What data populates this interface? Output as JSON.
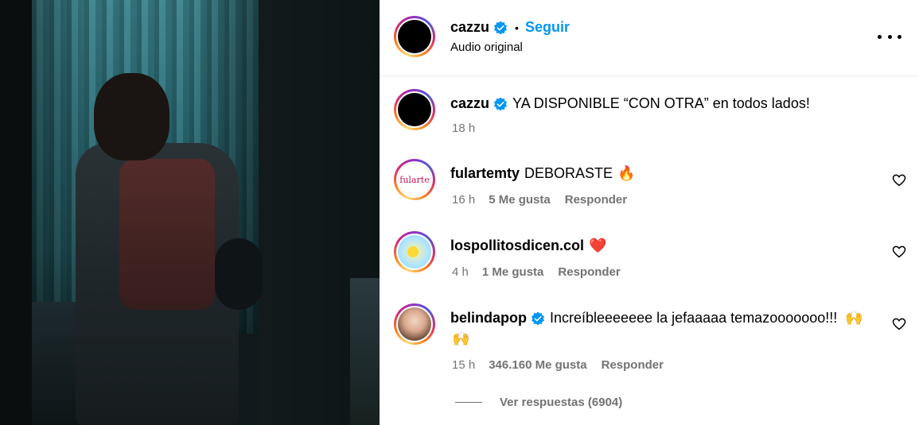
{
  "post": {
    "author": "cazzu",
    "follow_label": "Seguir",
    "separator": "•",
    "subtitle": "Audio original"
  },
  "caption": {
    "author": "cazzu",
    "text": "YA DISPONIBLE “CON OTRA” en todos lados!",
    "time": "18 h"
  },
  "comments": [
    {
      "author": "fulartemty",
      "text": "DEBORASTE",
      "emoji": "🔥",
      "time": "16 h",
      "likes": "5 Me gusta",
      "reply": "Responder"
    },
    {
      "author": "lospollitosdicen.col",
      "text": "",
      "emoji": "❤️",
      "time": "4 h",
      "likes": "1 Me gusta",
      "reply": "Responder"
    },
    {
      "author": "belindapop",
      "text": "Increíbleeeeeee la jefaaaaa temazooooooo!!!",
      "emoji": "🙌",
      "emoji2": "🙌",
      "time": "15 h",
      "likes": "346.160 Me gusta",
      "reply": "Responder"
    }
  ],
  "view_replies": "Ver respuestas (6904)",
  "avatar_labels": {
    "fulartemty": "fularte"
  },
  "colors": {
    "accent": "#0095f6",
    "meta": "#737373",
    "verified": "#0095f6"
  }
}
